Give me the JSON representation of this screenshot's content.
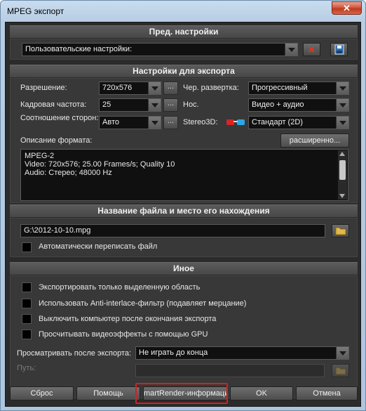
{
  "window": {
    "title": "MPEG экспорт",
    "close_glyph": "✕"
  },
  "presets": {
    "header": "Пред. настройки",
    "value": "Пользовательские настройки:"
  },
  "export": {
    "header": "Настройки для экспорта",
    "resolution_label": "Разрешение:",
    "resolution_value": "720x576",
    "interlace_label": "Чер. развертка:",
    "interlace_value": "Прогрессивный",
    "framerate_label": "Кадровая частота:",
    "framerate_value": "25",
    "carrier_label": "Нос.",
    "carrier_value": "Видео + аудио",
    "aspect_label": "Соотношение сторон:",
    "aspect_value": "Авто",
    "stereo_label": "Stereo3D:",
    "stereo_value": "Стандарт (2D)",
    "format_desc_label": "Описание формата:",
    "advanced_button": "расширенно...",
    "description_lines": [
      "MPEG-2",
      "Video: 720x576; 25.00 Frames/s; Quality 10",
      "Audio: Стерео; 48000 Hz"
    ],
    "dots": "..."
  },
  "file": {
    "header": "Название файла и место его нахождения",
    "path_value": "G:\\2012-10-10.mpg",
    "overwrite_label": "Автоматически переписать файл"
  },
  "other": {
    "header": "Иное",
    "options": [
      "Экспортировать только выделенную область",
      "Использовать Anti-interlace-фильтр (подавляет мерцание)",
      "Выключить компьютер после окончания экспорта",
      "Просчитывать видеоэффекты с помощью GPU"
    ],
    "preview_label": "Просматривать после экспорта:",
    "preview_value": "Не играть до конца",
    "path_label": "Путь:"
  },
  "buttons": {
    "reset": "Сброс",
    "help": "Помощь",
    "smartrender": "martRender-информация",
    "ok": "OK",
    "cancel": "Отмена"
  },
  "colors": {
    "highlight": "#d42020",
    "panel": "#2b2b2b"
  }
}
